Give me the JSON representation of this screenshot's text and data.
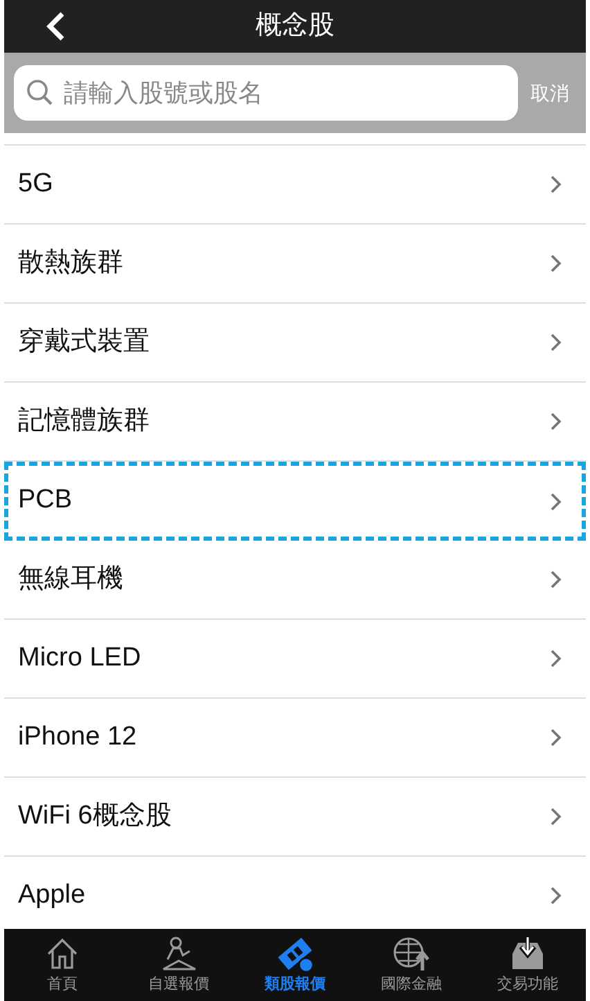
{
  "header": {
    "title": "概念股"
  },
  "search": {
    "placeholder": "請輸入股號或股名",
    "cancel": "取消"
  },
  "rows": [
    {
      "label": "5G",
      "highlighted": false
    },
    {
      "label": "散熱族群",
      "highlighted": false
    },
    {
      "label": "穿戴式裝置",
      "highlighted": false
    },
    {
      "label": "記憶體族群",
      "highlighted": false
    },
    {
      "label": "PCB",
      "highlighted": true
    },
    {
      "label": "無線耳機",
      "highlighted": false
    },
    {
      "label": "Micro LED",
      "highlighted": false
    },
    {
      "label": "iPhone 12",
      "highlighted": false
    },
    {
      "label": "WiFi 6概念股",
      "highlighted": false
    },
    {
      "label": "Apple",
      "highlighted": false
    }
  ],
  "tab_bar": [
    {
      "label": "首頁",
      "kind": "home",
      "selected": false
    },
    {
      "label": "自選報價",
      "kind": "person",
      "selected": false
    },
    {
      "label": "類股報價",
      "kind": "film",
      "selected": true
    },
    {
      "label": "國際金融",
      "kind": "globe",
      "selected": false
    },
    {
      "label": "交易功能",
      "kind": "tray",
      "selected": false
    }
  ]
}
